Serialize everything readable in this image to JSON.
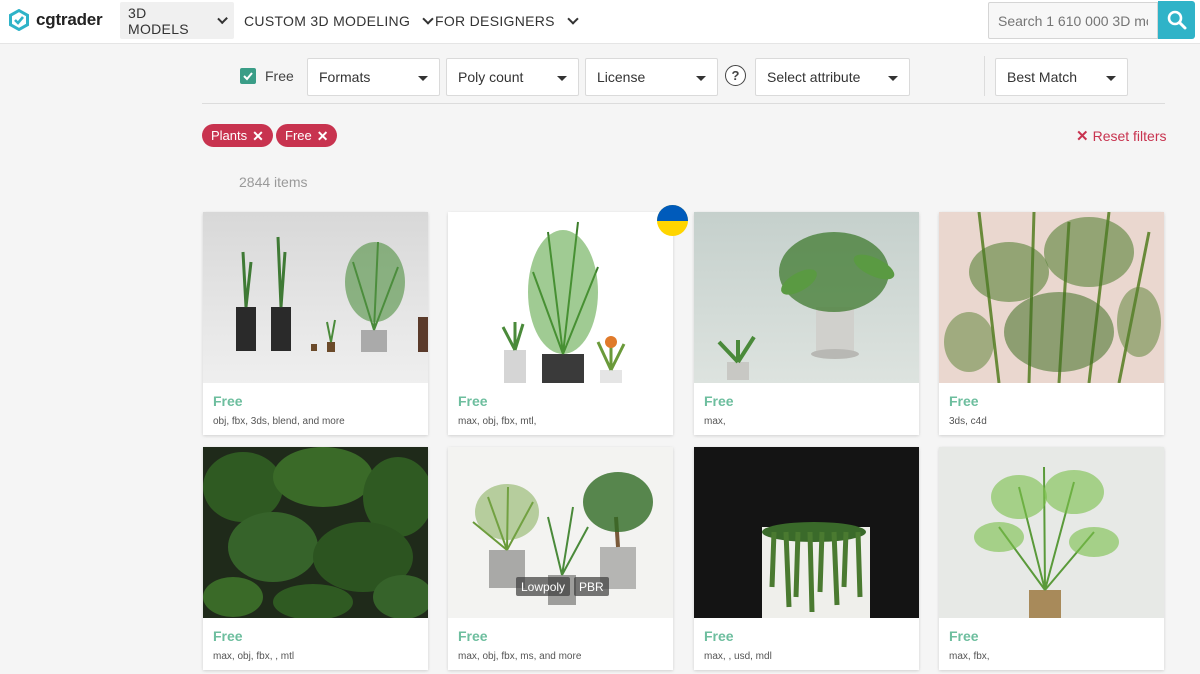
{
  "brand": {
    "name": "cgtrader",
    "accent": "#2fb3c8",
    "red": "#c8334f",
    "green": "#6dbe9e"
  },
  "nav": {
    "items": [
      {
        "label": "3D MODELS"
      },
      {
        "label": "CUSTOM 3D MODELING"
      },
      {
        "label": "FOR DESIGNERS"
      }
    ],
    "search_placeholder": "Search 1 610 000 3D mc"
  },
  "filters": {
    "free_label": "Free",
    "free_checked": true,
    "formats": "Formats",
    "poly_count": "Poly count",
    "license": "License",
    "help": "?",
    "attribute": "Select attribute",
    "sort": "Best Match"
  },
  "chips": [
    {
      "label": "Plants"
    },
    {
      "label": "Free"
    }
  ],
  "reset_label": "Reset filters",
  "items_count": "2844 items",
  "cards": [
    {
      "price": "Free",
      "formats": "obj, fbx, 3ds, blend, and more",
      "tags": []
    },
    {
      "price": "Free",
      "formats": "max, obj, fbx, mtl,",
      "tags": []
    },
    {
      "price": "Free",
      "formats": "max,",
      "tags": []
    },
    {
      "price": "Free",
      "formats": "3ds, c4d",
      "tags": []
    },
    {
      "price": "Free",
      "formats": "max, obj, fbx, , mtl",
      "tags": []
    },
    {
      "price": "Free",
      "formats": "max, obj, fbx, ms, and more",
      "tags": [
        "Lowpoly",
        "PBR"
      ]
    },
    {
      "price": "Free",
      "formats": "max, , usd, mdl",
      "tags": []
    },
    {
      "price": "Free",
      "formats": "max, fbx,",
      "tags": []
    }
  ]
}
